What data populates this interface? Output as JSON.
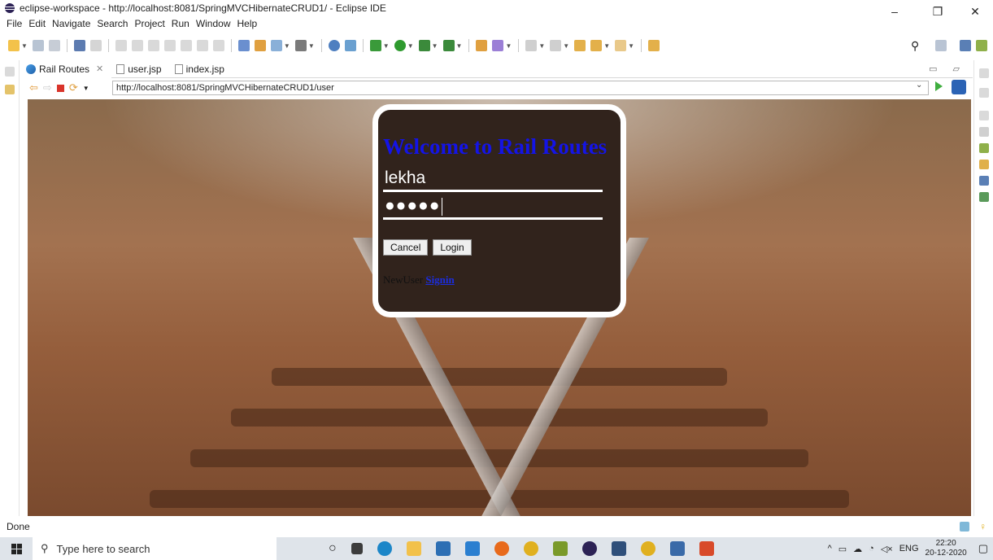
{
  "window": {
    "title": "eclipse-workspace - http://localhost:8081/SpringMVCHibernateCRUD1/ - Eclipse IDE",
    "minimize": "–",
    "maximize": "❐",
    "close": "✕"
  },
  "menu": {
    "items": [
      "File",
      "Edit",
      "Navigate",
      "Search",
      "Project",
      "Run",
      "Window",
      "Help"
    ]
  },
  "tabs": [
    {
      "label": "Rail Routes",
      "close": "✕"
    },
    {
      "label": "user.jsp"
    },
    {
      "label": "index.jsp"
    }
  ],
  "browser": {
    "url": "http://localhost:8081/SpringMVCHibernateCRUD1/user"
  },
  "page": {
    "title": "Welcome to Rail Routes",
    "username_value": "lekha",
    "password_mask": "●●●●●",
    "cancel_label": "Cancel",
    "login_label": "Login",
    "newuser_text": "NewUser",
    "signin_link": "Signin"
  },
  "status": {
    "text": "Done"
  },
  "taskbar": {
    "search_placeholder": "Type here to search",
    "language": "ENG",
    "time": "22:20",
    "date": "20-12-2020"
  },
  "colors": {
    "title_blue": "#1414e6",
    "card_bg": "#31231c",
    "link_blue": "#1b2de0"
  }
}
